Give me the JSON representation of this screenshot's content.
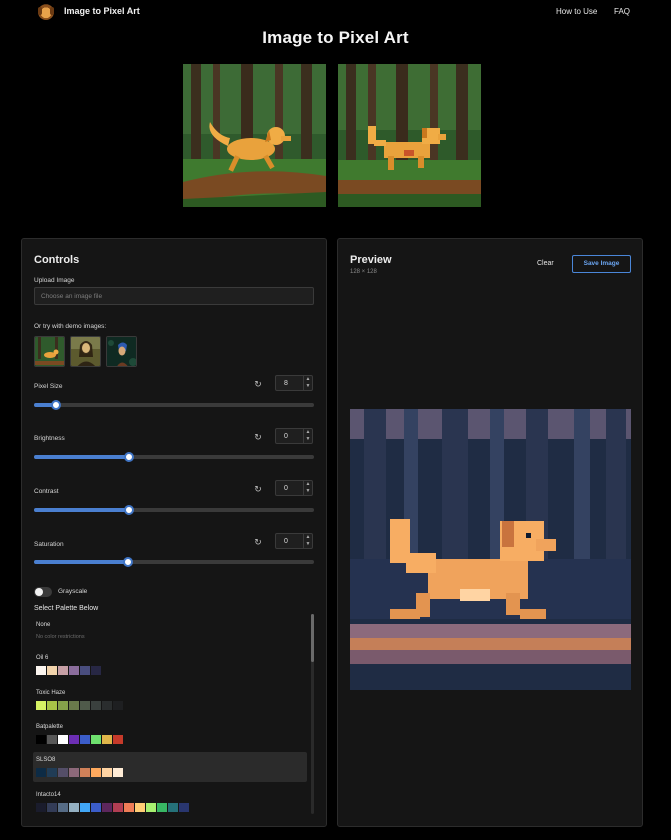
{
  "nav": {
    "brand": "Image to Pixel Art",
    "links": [
      "How to Use",
      "FAQ"
    ],
    "logo_icon": "dog-logo-icon"
  },
  "page": {
    "title": "Image to Pixel Art"
  },
  "controls": {
    "title": "Controls",
    "upload_label": "Upload Image",
    "upload_placeholder": "Choose an image file",
    "demo_label": "Or try with demo images:",
    "sliders": [
      {
        "label": "Pixel Size",
        "value": "8",
        "fraction": 0.08
      },
      {
        "label": "Brightness",
        "value": "0",
        "fraction": 0.34
      },
      {
        "label": "Contrast",
        "value": "0",
        "fraction": 0.34
      },
      {
        "label": "Saturation",
        "value": "0",
        "fraction": 0.335
      }
    ],
    "grayscale_label": "Grayscale",
    "palette_heading": "Select Palette Below",
    "palettes": [
      {
        "name": "None",
        "subtitle": "No color restrictions",
        "colors": []
      },
      {
        "name": "Oil 6",
        "subtitle": "",
        "colors": [
          "#fbf5ef",
          "#f2d3ab",
          "#c69fa5",
          "#8b6d9c",
          "#494d7e",
          "#272744"
        ]
      },
      {
        "name": "Toxic Haze",
        "subtitle": "",
        "colors": [
          "#d6f264",
          "#a7c447",
          "#85a24a",
          "#6a7a4b",
          "#4f5a4a",
          "#3a403e",
          "#2a2d2e",
          "#1e1f21"
        ]
      },
      {
        "name": "Batpalette",
        "subtitle": "",
        "colors": [
          "#000000",
          "#575757",
          "#ffffff",
          "#6c2eb4",
          "#3b5dc9",
          "#6ee06e",
          "#e0b64a",
          "#c63a2a"
        ]
      },
      {
        "name": "SLSO8",
        "subtitle": "",
        "colors": [
          "#0d2b45",
          "#203c56",
          "#544e68",
          "#8d697a",
          "#d08159",
          "#ffaa5e",
          "#ffd4a3",
          "#ffecd6"
        ],
        "active": true
      },
      {
        "name": "Intacto14",
        "subtitle": "",
        "colors": [
          "#1a1c2c",
          "#333c57",
          "#566c86",
          "#94b0c2",
          "#41a6f6",
          "#3b5dc9",
          "#5d275d",
          "#b13e53",
          "#ef7d57",
          "#ffcd75",
          "#a7f070",
          "#38b764",
          "#257179",
          "#29366f"
        ]
      }
    ]
  },
  "preview": {
    "title": "Preview",
    "dimensions": "128 × 128",
    "clear_label": "Clear",
    "save_label": "Save Image"
  }
}
